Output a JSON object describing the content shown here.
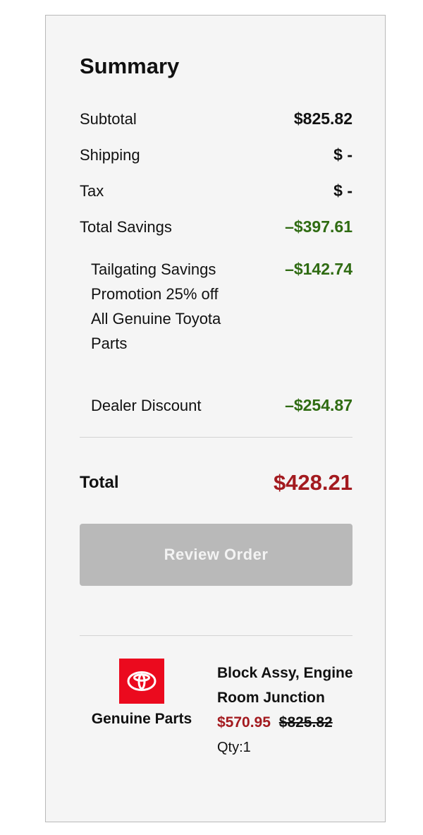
{
  "summary": {
    "title": "Summary",
    "subtotal": {
      "label": "Subtotal",
      "value": "$825.82"
    },
    "shipping": {
      "label": "Shipping",
      "value": "$ -"
    },
    "tax": {
      "label": "Tax",
      "value": "$ -"
    },
    "total_savings": {
      "label": "Total Savings",
      "value": "–$397.61"
    },
    "promotion": {
      "label": "Tailgating Savings Promotion 25% off All Genuine Toyota Parts",
      "value": "–$142.74"
    },
    "dealer_discount": {
      "label": "Dealer Discount",
      "value": "–$254.87"
    },
    "total": {
      "label": "Total",
      "value": "$428.21"
    }
  },
  "actions": {
    "review_order_label": "Review Order"
  },
  "item": {
    "brand_label": "Genuine Parts",
    "logo_icon": "toyota-logo-icon",
    "name": "Block Assy, Engine Room Junction",
    "sale_price": "$570.95",
    "original_price": "$825.82",
    "quantity": "Qty:1"
  },
  "colors": {
    "savings_green": "#2f6b12",
    "price_red": "#a31a1f",
    "logo_red": "#eb0a1e",
    "button_disabled_gray": "#b9b9b9"
  }
}
